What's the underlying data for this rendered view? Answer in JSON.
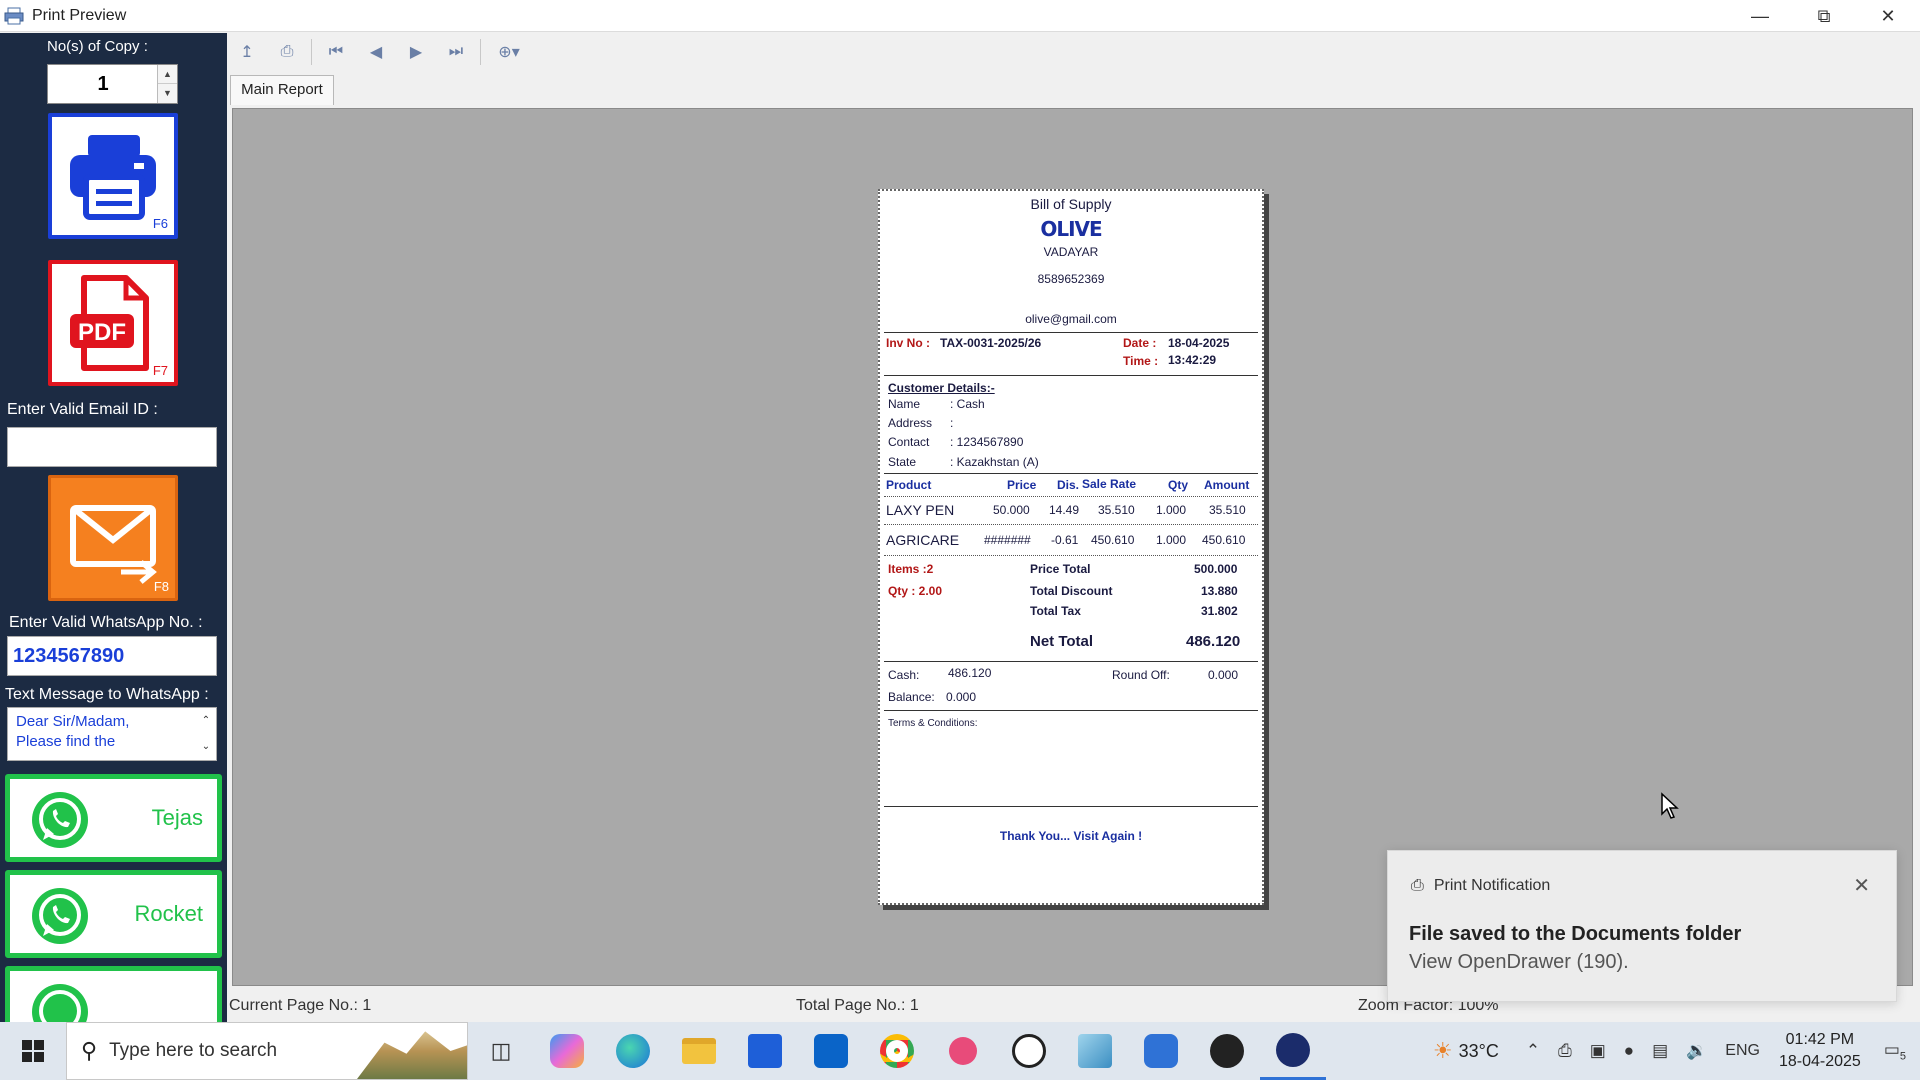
{
  "window": {
    "title": "Print Preview"
  },
  "sidebar": {
    "copies_label": "No(s) of Copy :",
    "copies_value": "1",
    "print_key": "F6",
    "pdf_text": "PDF",
    "pdf_key": "F7",
    "email_label": "Enter Valid Email ID :",
    "email_value": "",
    "mail_key": "F8",
    "whatsapp_label": "Enter Valid WhatsApp No. :",
    "whatsapp_value": "1234567890",
    "message_label": "Text Message to WhatsApp :",
    "message_value": "Dear Sir/Madam,\nPlease find the",
    "wa_buttons": [
      "Tejas",
      "Rocket"
    ]
  },
  "tabs": {
    "main": "Main Report"
  },
  "bill": {
    "heading": "Bill of Supply",
    "company": "OLIVE",
    "city": "VADAYAR",
    "phone": "8589652369",
    "email": "olive@gmail.com",
    "inv_label": "Inv No :",
    "inv_no": "TAX-0031-2025/26",
    "date_label": "Date :",
    "date": "18-04-2025",
    "time_label": "Time :",
    "time": "13:42:29",
    "customer_heading": "Customer Details:-",
    "customer": [
      {
        "k": "Name",
        "v": ": Cash"
      },
      {
        "k": "Address",
        "v": ":"
      },
      {
        "k": "Contact",
        "v": ": 1234567890"
      },
      {
        "k": "State",
        "v": ": Kazakhstan (A)"
      }
    ],
    "columns": [
      "Product",
      "Price",
      "Dis.",
      "Sale Rate",
      "Qty",
      "Amount"
    ],
    "items": [
      {
        "product": "LAXY PEN",
        "price": "50.000",
        "dis": "14.49",
        "rate": "35.510",
        "qty": "1.000",
        "amount": "35.510"
      },
      {
        "product": "AGRICARE",
        "price": "#######",
        "dis": "-0.61",
        "rate": "450.610",
        "qty": "1.000",
        "amount": "450.610"
      }
    ],
    "items_count": "Items :2",
    "qty_total": "Qty : 2.00",
    "price_total_label": "Price Total",
    "price_total": "500.000",
    "discount_label": "Total Discount",
    "discount": "13.880",
    "tax_label": "Total Tax",
    "tax": "31.802",
    "net_label": "Net Total",
    "net": "486.120",
    "cash_label": "Cash:",
    "cash": "486.120",
    "roundoff_label": "Round Off:",
    "roundoff": "0.000",
    "balance_label": "Balance:",
    "balance": "0.000",
    "terms": "Terms & Conditions:",
    "thanks": "Thank You... Visit Again !"
  },
  "status": {
    "current_page": "Current Page No.: 1",
    "total_page": "Total Page No.: 1",
    "zoom": "Zoom Factor: 100%"
  },
  "toast": {
    "app": "Print Notification",
    "title": "File saved to the Documents folder",
    "body": "View OpenDrawer (190)."
  },
  "taskbar": {
    "search_placeholder": "Type here to search",
    "temperature": "33°C",
    "language": "ENG",
    "time": "01:42 PM",
    "date": "18-04-2025",
    "notif_count": "5"
  },
  "colors": {
    "sidebar": "#1c2b43",
    "whatsapp": "#21c24a",
    "print": "#1a3fd8",
    "pdf": "#e0141e",
    "mail": "#f5801f"
  }
}
